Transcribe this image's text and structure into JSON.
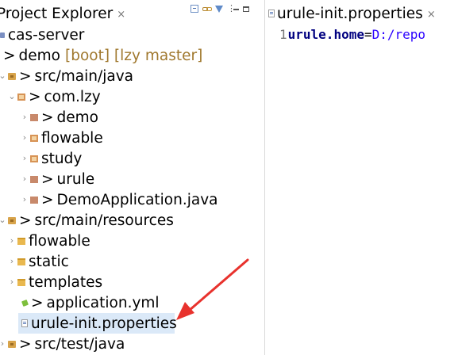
{
  "explorer": {
    "title": "Project Explorer",
    "close_glyph": "×",
    "toolbar": [
      {
        "icon": "collapse-all-icon"
      },
      {
        "icon": "link-with-editor-icon"
      },
      {
        "icon": "filter-icon"
      },
      {
        "icon": "view-menu-icon",
        "glyph": "⋮"
      },
      {
        "icon": "minimize-icon"
      },
      {
        "icon": "maximize-icon"
      }
    ],
    "tree": [
      {
        "text": "cas-server",
        "icon": "project-icon"
      },
      {
        "chev": "›",
        "dirty": ">",
        "text": "demo",
        "deco": "[boot] [lzy master]",
        "icon": "project-icon"
      },
      {
        "chev": "⌄",
        "dirty": ">",
        "text": "src/main/java",
        "icon": "source-folder-icon"
      },
      {
        "chev": "⌄",
        "dirty": ">",
        "text": "com.lzy",
        "icon": "package-icon"
      },
      {
        "chev": "›",
        "dirty": ">",
        "text": "demo",
        "icon": "package-icon"
      },
      {
        "chev": "›",
        "text": "flowable",
        "icon": "package-icon"
      },
      {
        "chev": "›",
        "text": "study",
        "icon": "package-icon"
      },
      {
        "chev": "›",
        "dirty": ">",
        "text": "urule",
        "icon": "package-icon"
      },
      {
        "chev": "›",
        "dirty": ">",
        "text": "DemoApplication.java",
        "icon": "java-file-icon"
      },
      {
        "chev": "⌄",
        "dirty": ">",
        "text": "src/main/resources",
        "icon": "source-folder-icon"
      },
      {
        "chev": "›",
        "text": "flowable",
        "icon": "folder-icon"
      },
      {
        "chev": "›",
        "text": "static",
        "icon": "folder-icon"
      },
      {
        "chev": "›",
        "text": "templates",
        "icon": "folder-icon"
      },
      {
        "dirty": ">",
        "text": "application.yml",
        "icon": "yml-file-icon"
      },
      {
        "text": "urule-init.properties",
        "icon": "properties-file-icon",
        "selected": true
      },
      {
        "chev": "›",
        "dirty": ">",
        "text": "src/test/java",
        "icon": "source-folder-icon"
      }
    ]
  },
  "editor": {
    "tab_title": "urule-init.properties",
    "close_glyph": "×",
    "line_number": "1",
    "key": "urule.home",
    "equals": "=",
    "value": "D:/repo"
  },
  "annotation": {
    "icon": "red-arrow-icon",
    "color": "#e8322d"
  },
  "colors": {
    "selection": "#dbe9f8",
    "property_key": "#000080",
    "property_value": "#2a00ff",
    "decoration": "#a0782e"
  }
}
